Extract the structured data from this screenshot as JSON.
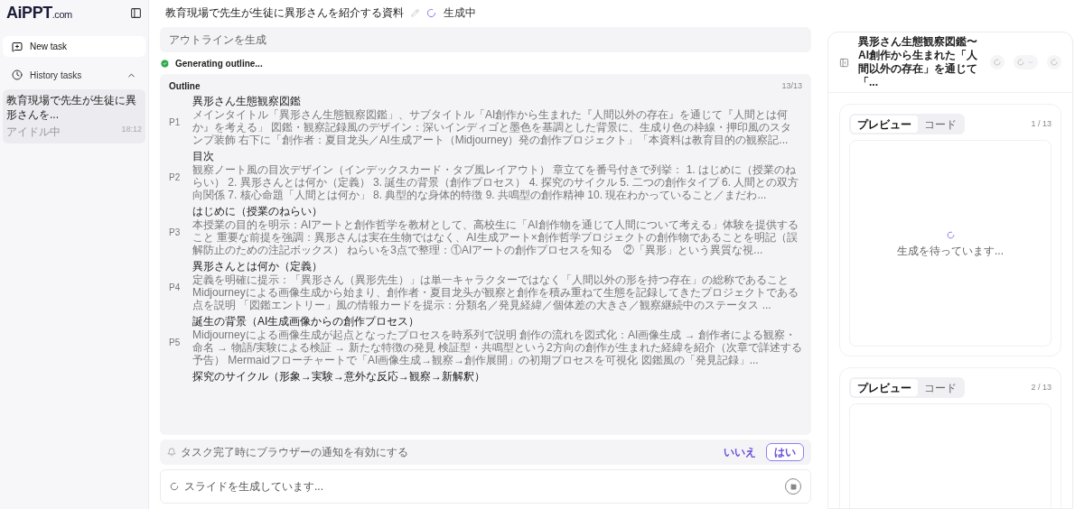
{
  "sidebar": {
    "logo": "AiPPT",
    "logo_suffix": ".com",
    "new_task": "New task",
    "history_label": "History tasks",
    "history_expanded": true,
    "history_items": [
      {
        "title": "教育現場で先生が生徒に異形さんを...",
        "status": "アイドル中",
        "time": "18:12",
        "selected": true
      }
    ]
  },
  "header": {
    "title": "教育現場で先生が生徒に異形さんを紹介する資料",
    "status": "生成中"
  },
  "step": {
    "label": "アウトラインを生成"
  },
  "progress": {
    "label": "Generating outline...",
    "done": true
  },
  "outline": {
    "title": "Outline",
    "count": "13/13",
    "items": [
      {
        "page": "P1",
        "title": "異形さん生態観察図鑑",
        "description": "メインタイトル「異形さん生態観察図鑑」、サブタイトル「AI創作から生まれた『人間以外の存在』を通じて『人間とは何か』を考える」 図鑑・観察記録風のデザイン：深いインディゴと墨色を基調とした背景に、生成り色の枠線・押印風のスタンプ装飾 右下に「創作者：夏目龙头／AI生成アート（Midjourney）発の創作プロジェクト」「本資料は教育目的の観察記..."
      },
      {
        "page": "P2",
        "title": "目次",
        "description": "観察ノート風の目次デザイン（インデックスカード・タブ風レイアウト） 章立てを番号付きで列挙： 1. はじめに（授業のねらい） 2. 異形さんとは何か（定義） 3. 誕生の背景（創作プロセス） 4. 探究のサイクル 5. 二つの創作タイプ 6. 人間との双方向関係 7. 核心命題「人間とは何か」 8. 典型的な身体的特徴 9. 共鳴型の創作精神 10. 現在わかっていること／まだわ..."
      },
      {
        "page": "P3",
        "title": "はじめに（授業のねらい）",
        "description": "本授業の目的を明示：AIアートと創作哲学を教材として、高校生に「AI創作物を通じて人間について考える」体験を提供すること 重要な前提を強調：異形さんは実在生物ではなく、AI生成アート×創作哲学プロジェクトの創作物であることを明記（誤解防止のための注記ボックス） ねらいを3点で整理：①AIアートの創作プロセスを知る　②「異形」という異質な視..."
      },
      {
        "page": "P4",
        "title": "異形さんとは何か（定義）",
        "description": "定義を明確に提示：「異形さん（異形先生）」は単一キャラクターではなく「人間以外の形を持つ存在」の総称であること Midjourneyによる画像生成から始まり、創作者・夏目龙头が観察と創作を積み重ねて生態を記録してきたプロジェクトである点を説明 「図鑑エントリー」風の情報カードを提示：分類名／発見経緯／個体差の大きさ／観察継続中のステータス ..."
      },
      {
        "page": "P5",
        "title": "誕生の背景（AI生成画像からの創作プロセス）",
        "description": "Midjourneyによる画像生成が起点となったプロセスを時系列で説明 創作の流れを図式化：AI画像生成 → 創作者による観察・命名 → 物語/実験による検証 → 新たな特徴の発見 検証型・共鳴型という2方向の創作が生まれた経緯を紹介（次章で詳述する予告） Mermaidフローチャートで「AI画像生成→観察→創作展開」の初期プロセスを可視化 図鑑風の「発見記録」..."
      },
      {
        "title": "探究のサイクル（形象→実験→意外な反応→観察→新解釈）"
      }
    ]
  },
  "notification": {
    "text": "タスク完了時にブラウザーの通知を有効にする",
    "no": "いいえ",
    "yes": "はい"
  },
  "composer": {
    "status": "スライドを生成しています..."
  },
  "preview": {
    "title": "異形さん生態観察図鑑〜AI創作から生まれた「人間以外の存在」を通じて「...",
    "slides": [
      {
        "tabs": [
          {
            "label": "プレビュー",
            "selected": true
          },
          {
            "label": "コード",
            "selected": false
          }
        ],
        "counter": "1 / 13",
        "message": "生成を待っています..."
      },
      {
        "tabs": [
          {
            "label": "プレビュー",
            "selected": true
          },
          {
            "label": "コード",
            "selected": false
          }
        ],
        "counter": "2 / 13"
      }
    ]
  }
}
